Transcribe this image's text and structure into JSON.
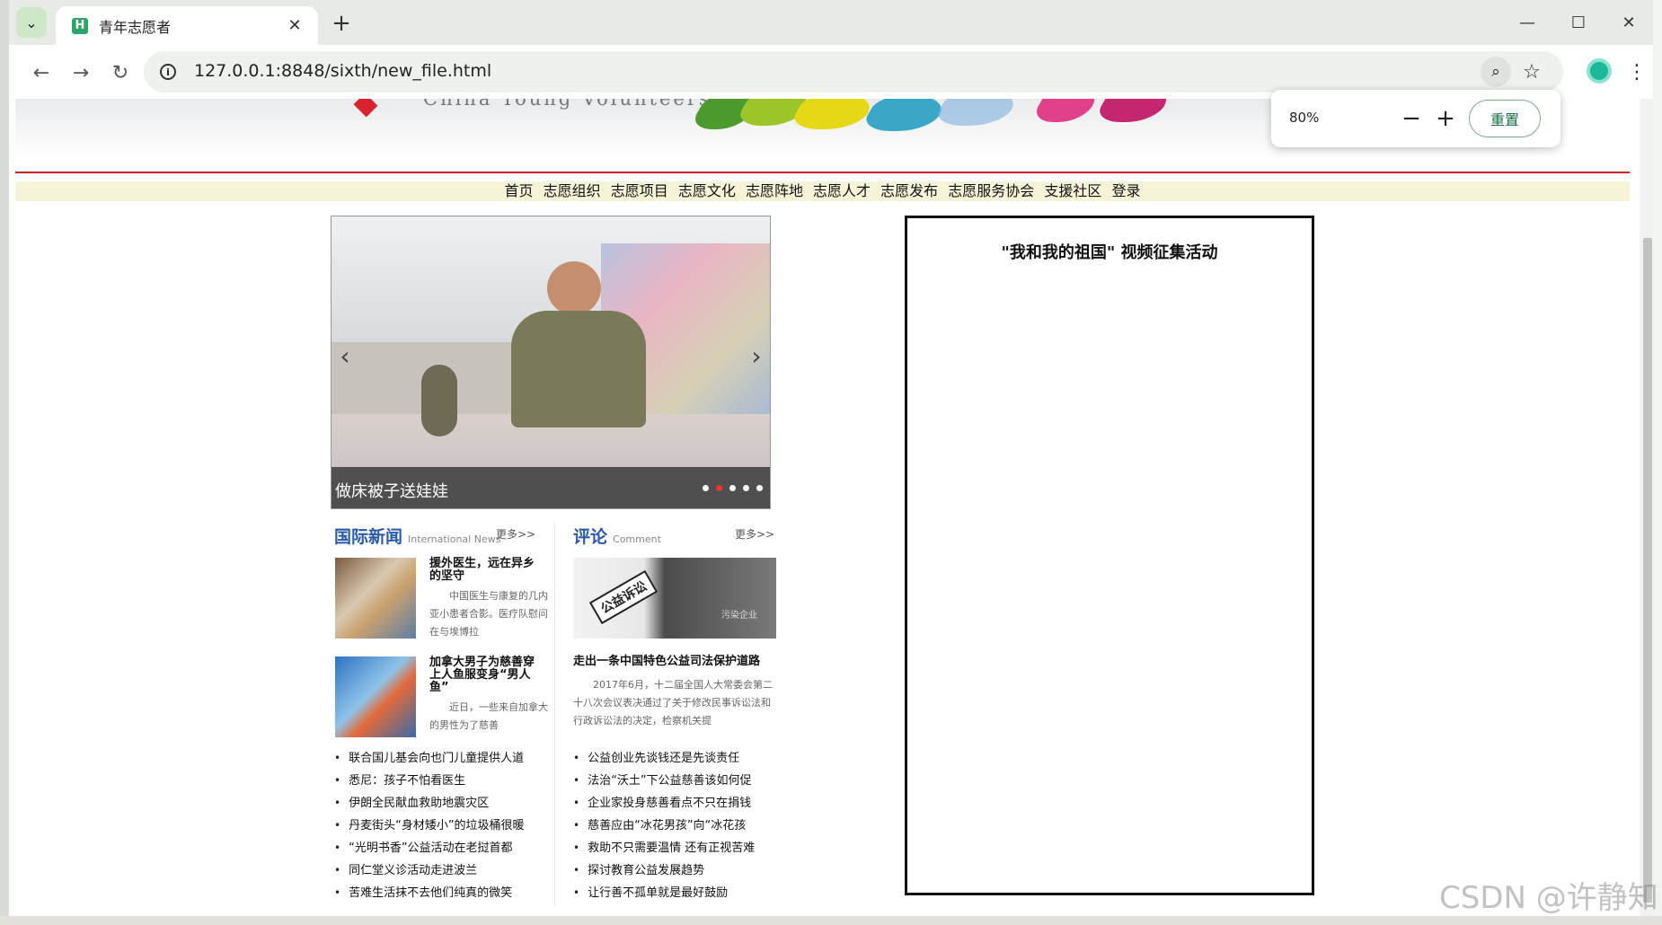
{
  "browser": {
    "tab_title": "青年志愿者",
    "tab_favicon": "H",
    "url": "127.0.0.1:8848/sixth/new_file.html",
    "zoom_value": "80%",
    "zoom_reset_label": "重置",
    "zoom_minus": "−",
    "zoom_plus": "+"
  },
  "banner": {
    "subtitle": "China Young Volunteers"
  },
  "nav": {
    "items": [
      "首页",
      "志愿组织",
      "志愿项目",
      "志愿文化",
      "志愿阵地",
      "志愿人才",
      "志愿发布",
      "志愿服务协会",
      "支援社区",
      "登录"
    ]
  },
  "slider": {
    "caption": "做床被子送娃娃",
    "dot_count": 5,
    "active_dot": 1
  },
  "intl_news": {
    "title": "国际新闻",
    "subtitle_en": "International News",
    "more": "更多>>",
    "featured": [
      {
        "title": "援外医生，远在异乡的坚守",
        "summary": "中国医生与康复的几内亚小患者合影。医疗队慰问在与埃博拉"
      },
      {
        "title": "加拿大男子为慈善穿上人鱼服变身“男人鱼”",
        "summary": "近日，一些来自加拿大的男性为了慈善"
      }
    ],
    "list": [
      "联合国儿基会向也门儿童提供人道",
      "悉尼：孩子不怕看医生",
      "伊朗全民献血救助地震灾区",
      "丹麦街头“身材矮小”的垃圾桶很暖",
      "“光明书香”公益活动在老挝首都",
      "同仁堂义诊活动走进波兰",
      "苦难生活抹不去他们纯真的微笑"
    ]
  },
  "comment": {
    "title": "评论",
    "subtitle_en": "Comment",
    "more": "更多>>",
    "image_text": "公益诉讼",
    "image_text2": "污染企业",
    "featured_title": "走出一条中国特色公益司法保护道路",
    "featured_summary": "2017年6月，十二届全国人大常委会第二十八次会议表决通过了关于修改民事诉讼法和行政诉讼法的决定，检察机关提",
    "list": [
      "公益创业先谈钱还是先谈责任",
      "法治“沃土”下公益慈善该如何促",
      "企业家投身慈善看点不只在捐钱",
      "慈善应由“冰花男孩”向“冰花孩",
      "救助不只需要温情 还有正视苦难",
      "探讨教育公益发展趋势",
      "让行善不孤单就是最好鼓励"
    ]
  },
  "video_box": {
    "title": "\"我和我的祖国\" 视频征集活动"
  },
  "watermark": "CSDN @许静知",
  "colors": {
    "accent_red": "#d41f1f",
    "nav_bg": "#f6f4d8",
    "section_title_blue": "#2a5aa6"
  }
}
